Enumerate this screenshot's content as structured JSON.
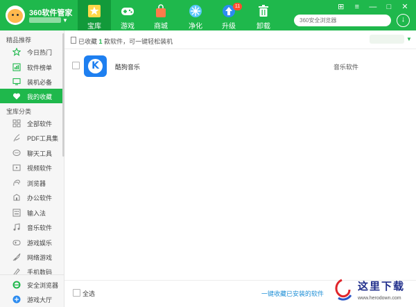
{
  "header": {
    "brand_title": "360软件管家",
    "search_placeholder": "360安全浏览器",
    "tabs": [
      {
        "label": "宝库",
        "icon": "star-icon",
        "active": true
      },
      {
        "label": "游戏",
        "icon": "gamepad-icon",
        "active": false
      },
      {
        "label": "商城",
        "icon": "shopping-bag-icon",
        "active": false
      },
      {
        "label": "净化",
        "icon": "purify-icon",
        "active": false
      },
      {
        "label": "升级",
        "icon": "upgrade-arrow-icon",
        "active": false,
        "badge": "11"
      },
      {
        "label": "卸载",
        "icon": "trash-icon",
        "active": false
      }
    ],
    "window_controls": [
      "⊞",
      "≡",
      "—",
      "□",
      "✕"
    ]
  },
  "sidebar": {
    "section1_title": "精品推荐",
    "section1_items": [
      {
        "label": "今日热门",
        "icon": "star-outline-icon"
      },
      {
        "label": "软件榜单",
        "icon": "rank-list-icon"
      },
      {
        "label": "装机必备",
        "icon": "monitor-icon"
      },
      {
        "label": "我的收藏",
        "icon": "heart-icon",
        "active": true
      }
    ],
    "section2_title": "宝库分类",
    "section2_items": [
      {
        "label": "全部软件",
        "icon": "grid-icon"
      },
      {
        "label": "PDF工具集",
        "icon": "pdf-icon"
      },
      {
        "label": "聊天工具",
        "icon": "chat-icon"
      },
      {
        "label": "视频软件",
        "icon": "video-icon"
      },
      {
        "label": "浏览器",
        "icon": "browser-icon"
      },
      {
        "label": "办公软件",
        "icon": "office-icon"
      },
      {
        "label": "输入法",
        "icon": "keyboard-icon"
      },
      {
        "label": "音乐软件",
        "icon": "music-icon"
      },
      {
        "label": "游戏娱乐",
        "icon": "game-icon"
      },
      {
        "label": "网络游戏",
        "icon": "online-game-icon"
      },
      {
        "label": "手机数码",
        "icon": "phone-icon"
      }
    ],
    "footer_items": [
      {
        "label": "安全浏览器",
        "icon": "ie-browser-icon"
      },
      {
        "label": "游戏大厅",
        "icon": "game-hall-icon"
      }
    ]
  },
  "main": {
    "info_prefix": "已收藏",
    "info_count": "1",
    "info_suffix": "款软件，可一键轻松装机",
    "apps": [
      {
        "name": "酷狗音乐",
        "category": "音乐软件",
        "icon_letter": "K"
      }
    ],
    "select_all_label": "全选",
    "collect_link": "一键收藏已安装的软件"
  },
  "watermark": {
    "title": "这里下载",
    "url": "www.herodown.com"
  },
  "colors": {
    "brand_green": "#1fb84c",
    "active_tab": "#129a3a",
    "badge_red": "#ff4d2e",
    "link_blue": "#1e8fd6",
    "kugou_blue": "#1e7ff0"
  }
}
